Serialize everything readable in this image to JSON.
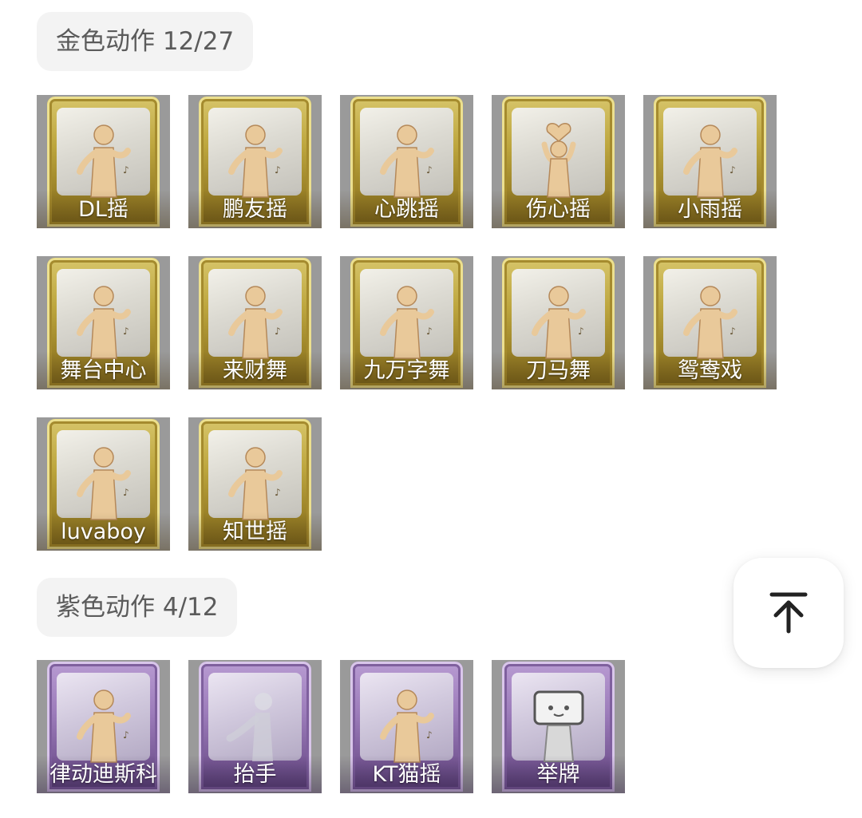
{
  "gold_section": {
    "title": "金色动作 12/27",
    "items": [
      {
        "label": "DL摇",
        "icon": "dance-pose-icon"
      },
      {
        "label": "鹏友摇",
        "icon": "dance-pose-icon"
      },
      {
        "label": "心跳摇",
        "icon": "dance-pose-icon"
      },
      {
        "label": "伤心摇",
        "icon": "heart-pose-icon"
      },
      {
        "label": "小雨摇",
        "icon": "dance-pose-icon"
      },
      {
        "label": "舞台中心",
        "icon": "dance-pose-icon"
      },
      {
        "label": "来财舞",
        "icon": "dance-pose-icon"
      },
      {
        "label": "九万字舞",
        "icon": "dance-pose-icon"
      },
      {
        "label": "刀马舞",
        "icon": "dance-pose-icon"
      },
      {
        "label": "鸳鸯戏",
        "icon": "dance-pose-icon"
      },
      {
        "label": "luvaboy",
        "icon": "dance-pose-icon"
      },
      {
        "label": "知世摇",
        "icon": "dance-pose-icon"
      }
    ],
    "colors": {
      "frame": "#c2ab45",
      "backdrop": "#9a9a9a"
    }
  },
  "purple_section": {
    "title": "紫色动作 4/12",
    "items": [
      {
        "label": "律动迪斯科",
        "icon": "dance-pose-icon"
      },
      {
        "label": "抬手",
        "icon": "raise-hand-pose-icon"
      },
      {
        "label": "KT猫摇",
        "icon": "dance-pose-icon"
      },
      {
        "label": "举牌",
        "icon": "hold-sign-pose-icon"
      }
    ],
    "colors": {
      "frame": "#9c7cba",
      "backdrop": "#9a9a9a"
    }
  },
  "back_to_top": {
    "icon": "arrow-up-to-top-icon"
  }
}
